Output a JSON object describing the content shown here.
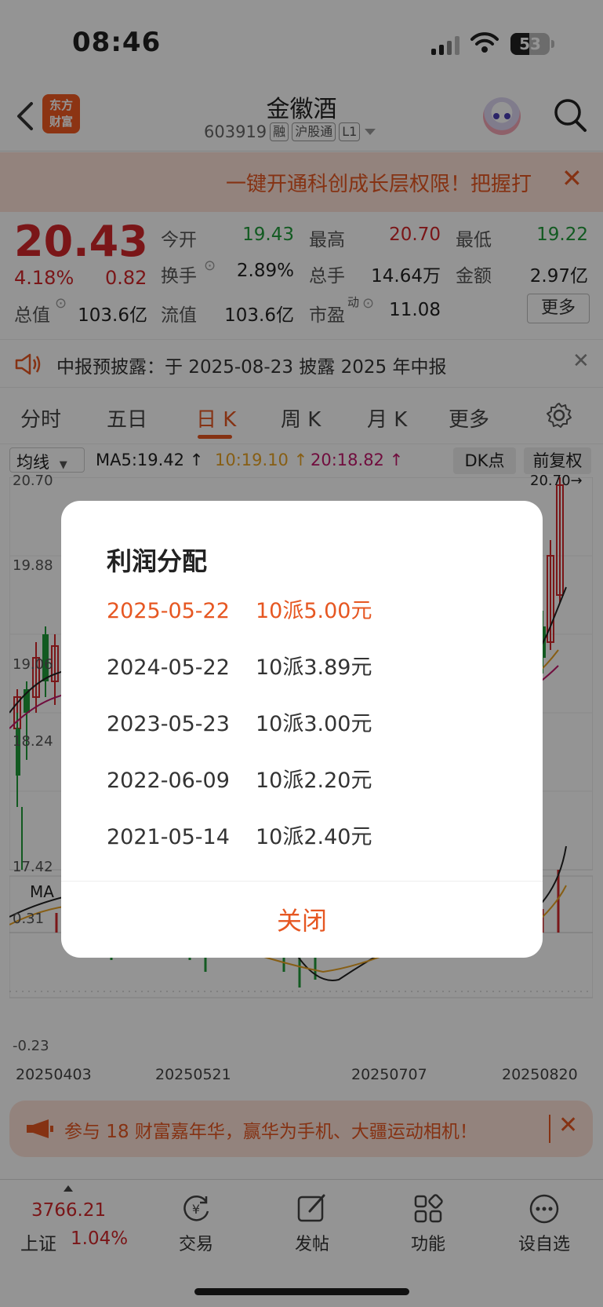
{
  "status": {
    "time": "08:46",
    "battery": "53"
  },
  "header": {
    "logo_line1": "东方",
    "logo_line2": "财富",
    "title": "金徽酒",
    "code": "603919",
    "tags": [
      "融",
      "沪股通",
      "L1"
    ]
  },
  "banner": {
    "text": "一键开通科创成长层权限！把握打"
  },
  "quote": {
    "price": "20.43",
    "change_pct": "4.18%",
    "change": "0.82",
    "fields": [
      {
        "label": "今开",
        "value": "19.43",
        "color": "green"
      },
      {
        "label": "最高",
        "value": "20.70",
        "color": "red"
      },
      {
        "label": "最低",
        "value": "19.22",
        "color": "green"
      },
      {
        "label": "换手",
        "value": "2.89%",
        "color": "dark"
      },
      {
        "label": "总手",
        "value": "14.64万",
        "color": "dark"
      },
      {
        "label": "金额",
        "value": "2.97亿",
        "color": "dark"
      },
      {
        "label": "总值",
        "value": "103.6亿",
        "color": "dark"
      },
      {
        "label": "流值",
        "value": "103.6亿",
        "color": "dark"
      },
      {
        "label": "市盈",
        "value": "11.08",
        "color": "dark"
      }
    ],
    "pe_superscript": "动",
    "more": "更多"
  },
  "notice": {
    "text": "中报预披露：于 2025-08-23 披露 2025 年中报"
  },
  "tabs": [
    "分时",
    "五日",
    "日 K",
    "周 K",
    "月 K",
    "更多"
  ],
  "active_tab": 2,
  "ma": {
    "selector": "均线",
    "ma5": "MA5:19.42",
    "ma10": "10:19.10",
    "ma20": "20:18.82",
    "dk": "DK点",
    "adjust": "前复权"
  },
  "chart_labels": {
    "y_top": "20.70",
    "y2": "19.88",
    "y3": "19.06",
    "y4": "18.24",
    "y_low": "17.42",
    "high_marker": "20.70",
    "macd_label": "MA",
    "macd_top": "0.31",
    "macd_bottom": "-0.23",
    "dates": [
      "20250403",
      "20250521",
      "20250707",
      "20250820"
    ]
  },
  "modal": {
    "title": "利润分配",
    "rows": [
      {
        "date": "2025-05-22",
        "plan": "10派5.00元"
      },
      {
        "date": "2024-05-22",
        "plan": "10派3.89元"
      },
      {
        "date": "2023-05-23",
        "plan": "10派3.00元"
      },
      {
        "date": "2022-06-09",
        "plan": "10派2.20元"
      },
      {
        "date": "2021-05-14",
        "plan": "10派2.40元"
      }
    ],
    "close": "关闭"
  },
  "ad": {
    "text": "参与 18 财富嘉年华，赢华为手机、大疆运动相机！"
  },
  "bottom": {
    "index_value": "3766.21",
    "index_name": "上证",
    "index_change": "1.04%",
    "items": [
      "交易",
      "发帖",
      "功能",
      "设自选"
    ]
  },
  "colors": {
    "accent": "#e65722",
    "up": "#d3262a",
    "down": "#1f9b3a"
  }
}
